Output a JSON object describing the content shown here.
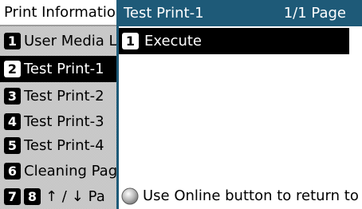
{
  "background_menu": {
    "title": "Print Information",
    "items": [
      {
        "number": "1",
        "label": "User Media L"
      },
      {
        "number": "2",
        "label": "Test Print-1",
        "selected": true
      },
      {
        "number": "3",
        "label": "Test Print-2"
      },
      {
        "number": "4",
        "label": "Test Print-3"
      },
      {
        "number": "5",
        "label": "Test Print-4"
      },
      {
        "number": "6",
        "label": "Cleaning Pag"
      }
    ],
    "nav": {
      "number_a": "7",
      "number_b": "8",
      "arrows": "↑ / ↓",
      "label": "Pa"
    }
  },
  "popup": {
    "title": "Test Print-1",
    "page": "1/1 Page",
    "items": [
      {
        "number": "1",
        "label": "Execute",
        "selected": true
      }
    ],
    "footer_text": "Use Online button to return to s...",
    "footer_icon": "online-button-icon"
  },
  "colors": {
    "header_bg": "#1e5a78",
    "selected_bg": "#000000",
    "selected_fg": "#ffffff"
  }
}
